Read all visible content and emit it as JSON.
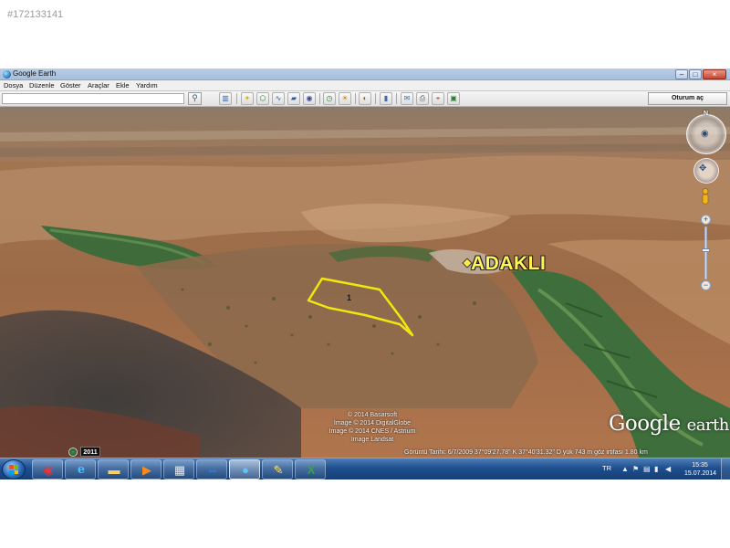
{
  "watermark": "#172133141",
  "window": {
    "title": "Google Earth"
  },
  "window_buttons": {
    "minimize": "–",
    "maximize": "□",
    "close": "×"
  },
  "menu": [
    "Dosya",
    "Düzenle",
    "Göster",
    "Araçlar",
    "Ekle",
    "Yardım"
  ],
  "toolbar": {
    "search_value": "",
    "search_icon": "magnifier-icon",
    "signin_label": "Oturum aç",
    "tools": [
      "sidebar-icon",
      "placemark-icon",
      "polygon-icon",
      "path-icon",
      "overlay-icon",
      "record-tour-icon",
      "historical-imagery-icon",
      "sunlight-icon",
      "planets-icon",
      "ruler-icon",
      "email-icon",
      "print-icon",
      "save-image-icon"
    ]
  },
  "map": {
    "place_label": "ADAKLI",
    "polygon_label": "1",
    "polygon_color": "#f2e60f",
    "north_label": "N",
    "credits": [
      "© 2014 Basarsoft",
      "Image © 2014 DigitalGlobe",
      "Image © 2014 CNES / Astrium",
      "Image Landsat"
    ],
    "logo_google": "Google",
    "logo_earth": "earth"
  },
  "statusbar": {
    "historical_year": "2011",
    "text": "Görüntü Tarihi: 6/7/2009    37°09'27.78\" K  37°40'31.32\" D   yük  743 m    göz irtifası    1.80 km"
  },
  "taskbar": {
    "apps": [
      "chrome-icon",
      "internet-explorer-icon",
      "file-explorer-icon",
      "media-player-icon",
      "calculator-icon",
      "teamviewer-icon",
      "google-earth-icon",
      "paint-icon",
      "excel-icon"
    ],
    "language": "TR",
    "time": "15:35",
    "date": "15.07.2014"
  }
}
